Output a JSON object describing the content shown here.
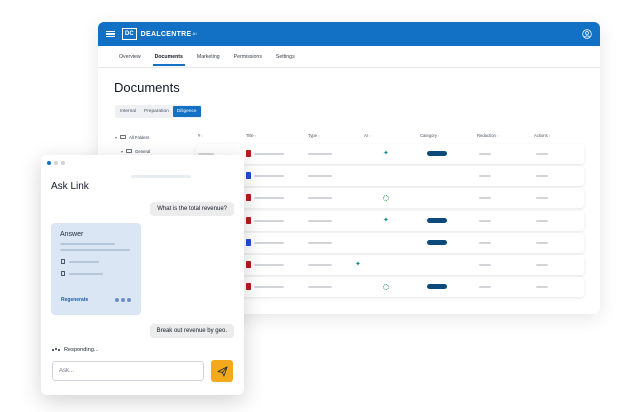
{
  "app": {
    "logo_mark": "DC",
    "brand_name": "DEALCENTRE",
    "brand_suffix": "AI",
    "tabs": [
      "Overview",
      "Documents",
      "Marketing",
      "Permissions",
      "Settings"
    ],
    "active_tab": "Documents",
    "page_title": "Documents",
    "segments": [
      "Internal",
      "Preparation",
      "Diligence"
    ],
    "active_segment": "Diligence",
    "tree": {
      "root": "All Folders",
      "child": "General"
    },
    "table": {
      "columns": [
        "#",
        "Title",
        "Type",
        "AI",
        "Category",
        "Redaction",
        "Actions"
      ],
      "rows": [
        {
          "file": "pdf",
          "ai": "sparkle",
          "badge": true
        },
        {
          "file": "doc",
          "ai": "",
          "badge": false
        },
        {
          "file": "pdf",
          "ai": "ring",
          "badge": false
        },
        {
          "file": "pdf",
          "ai": "sparkle",
          "badge": true
        },
        {
          "file": "doc",
          "ai": "",
          "badge": true
        },
        {
          "file": "pdf",
          "ai": "sparkle-left",
          "badge": false
        },
        {
          "file": "pdf",
          "ai": "ring",
          "badge": true
        }
      ]
    },
    "icons": {
      "menu": "menu-icon",
      "user": "user-circle-icon",
      "folder": "folder-icon",
      "pdf": "pdf-file-icon",
      "doc": "doc-file-icon",
      "ai": "sparkle-icon"
    },
    "colors": {
      "primary": "#1270c5",
      "badge": "#0b4a7a",
      "pdf": "#b91c1c",
      "doc": "#1d4ed8",
      "ai": "#0d8a8a",
      "send": "#f4a91d"
    }
  },
  "ask": {
    "title": "Ask Link",
    "question1": "What is the total revenue?",
    "answer_heading": "Answer",
    "regenerate_label": "Regenerate",
    "question2": "Break out revenue by geo.",
    "status": "Responding...",
    "input_placeholder": "Ask..."
  }
}
